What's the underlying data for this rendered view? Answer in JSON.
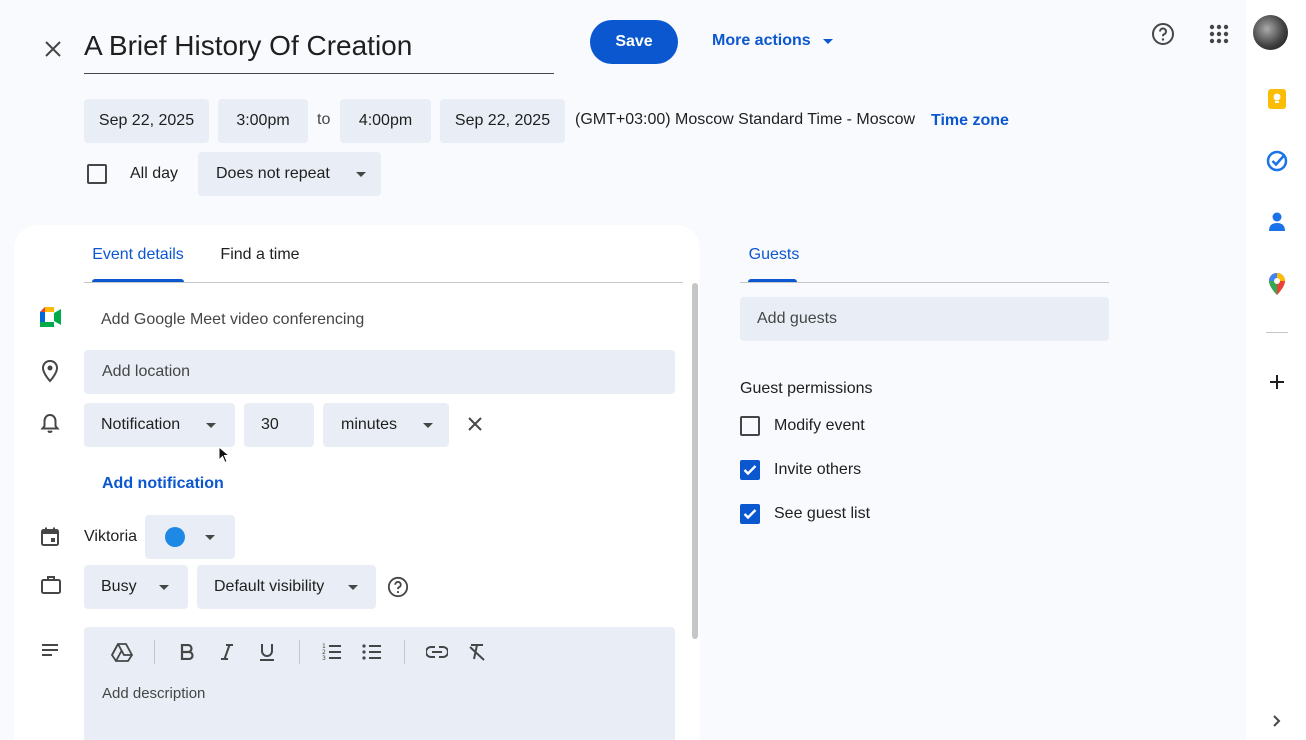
{
  "header": {
    "title": "A Brief History Of Creation",
    "save_label": "Save",
    "more_actions_label": "More actions"
  },
  "datetime": {
    "start_date": "Sep 22, 2025",
    "start_time": "3:00pm",
    "to_label": "to",
    "end_time": "4:00pm",
    "end_date": "Sep 22, 2025",
    "timezone_text": "(GMT+03:00) Moscow Standard Time - Moscow",
    "timezone_link": "Time zone",
    "all_day_label": "All day",
    "repeat_value": "Does not repeat"
  },
  "tabs": {
    "event_details": "Event details",
    "find_time": "Find a time"
  },
  "details": {
    "meet_label": "Add Google Meet video conferencing",
    "location_placeholder": "Add location",
    "notification_type": "Notification",
    "notification_value": "30",
    "notification_unit": "minutes",
    "add_notification": "Add notification",
    "calendar_owner": "Viktoria",
    "calendar_color": "#1e88e5",
    "busy_value": "Busy",
    "visibility_value": "Default visibility",
    "description_placeholder": "Add description"
  },
  "guests": {
    "tab_label": "Guests",
    "add_placeholder": "Add guests",
    "permissions_title": "Guest permissions",
    "permissions": [
      {
        "label": "Modify event",
        "checked": false
      },
      {
        "label": "Invite others",
        "checked": true
      },
      {
        "label": "See guest list",
        "checked": true
      }
    ]
  },
  "colors": {
    "accent": "#0b57d0",
    "field_bg": "#e9eef6",
    "page_bg": "#f8fafd"
  }
}
